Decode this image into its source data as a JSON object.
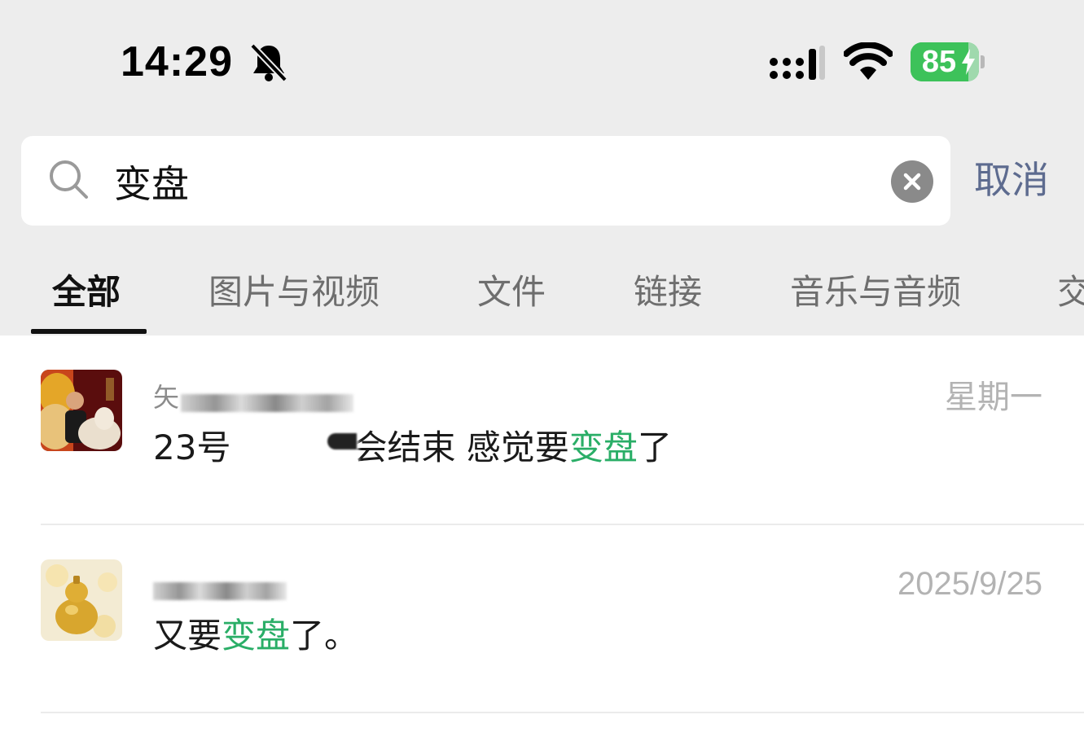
{
  "status_bar": {
    "time": "14:29",
    "battery_percent": "85",
    "battery_level": 0.85,
    "icons": [
      "bell-muted-icon",
      "cellular-signal-icon",
      "wifi-icon",
      "battery-charging-icon"
    ]
  },
  "search": {
    "query": "变盘",
    "cancel_label": "取消"
  },
  "tabs": [
    {
      "label": "全部",
      "active": true
    },
    {
      "label": "图片与视频",
      "active": false
    },
    {
      "label": "文件",
      "active": false
    },
    {
      "label": "链接",
      "active": false
    },
    {
      "label": "音乐与音频",
      "active": false
    },
    {
      "label": "交",
      "active": false
    }
  ],
  "results": [
    {
      "sender_visible": "矢",
      "time": "星期一",
      "snippet_before": "23号",
      "snippet_middle": "会结束 感觉要",
      "snippet_highlight": "变盘",
      "snippet_after": "了"
    },
    {
      "sender_visible": "",
      "time": "2025/9/25",
      "snippet_before": "又要",
      "snippet_highlight": "变盘",
      "snippet_after": "了。"
    }
  ],
  "colors": {
    "highlight": "#2aae67",
    "cancel": "#5d6b8f",
    "battery": "#3dc25a",
    "header_bg": "#ededed"
  }
}
